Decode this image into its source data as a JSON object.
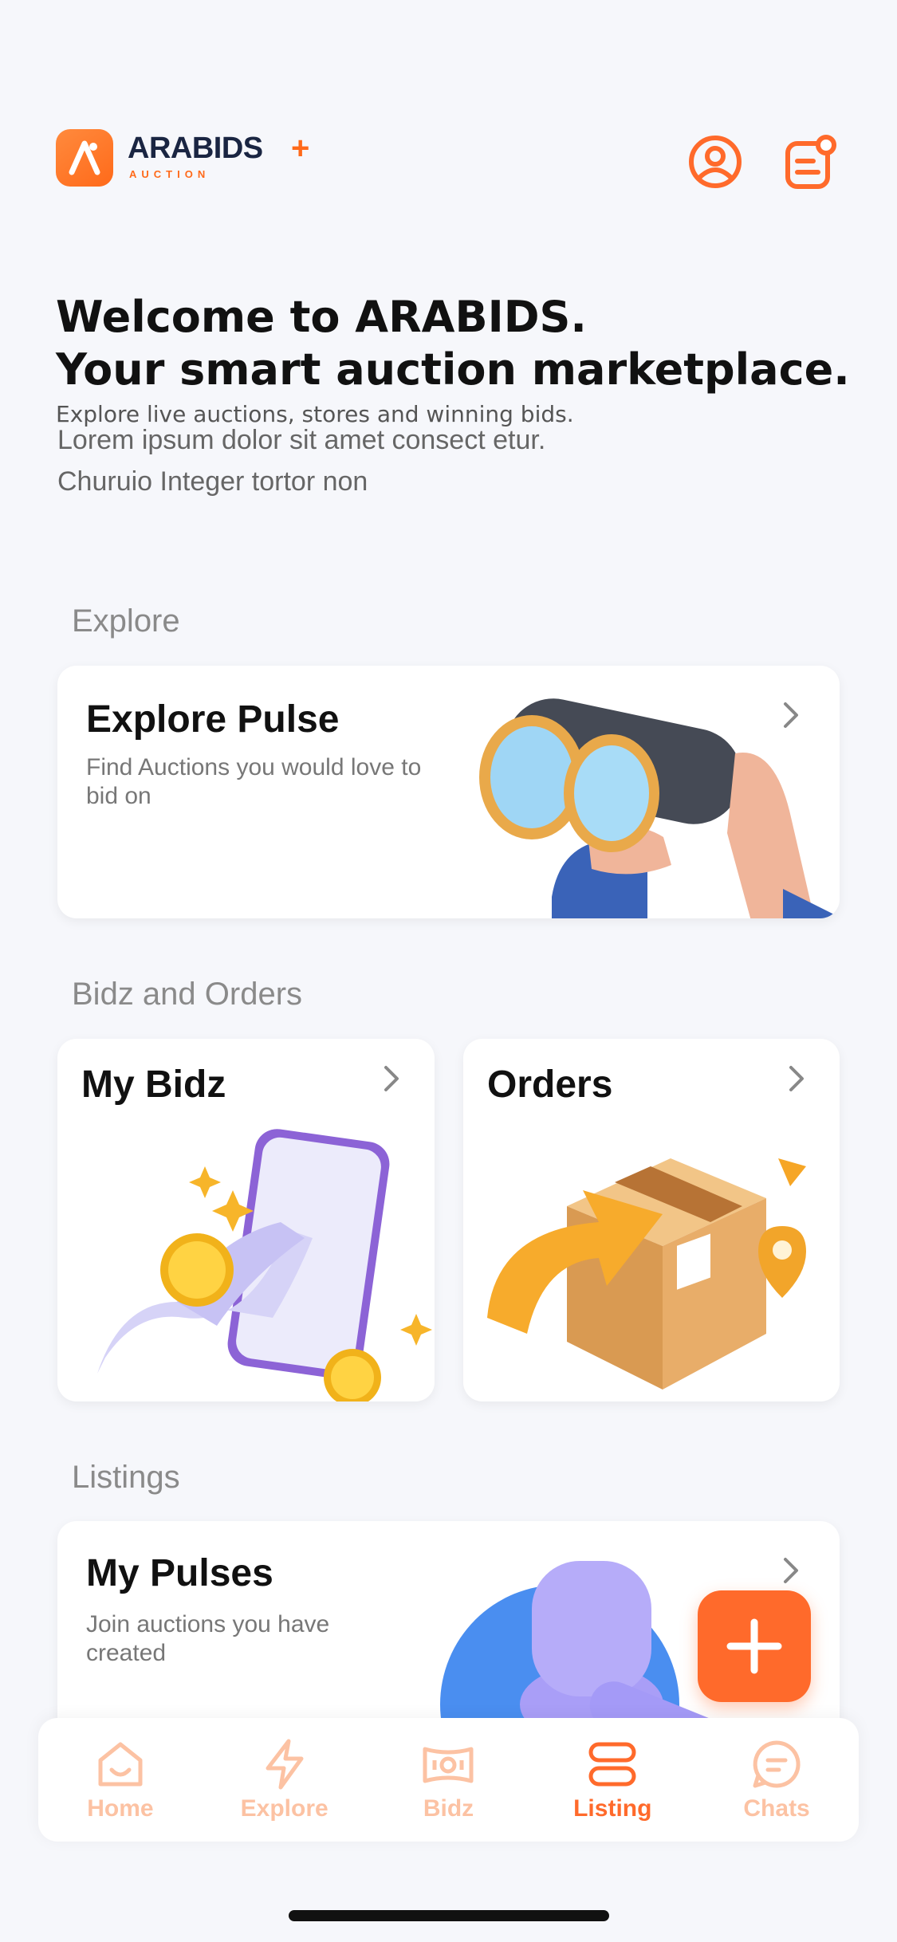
{
  "header": {
    "brand_name": "ARABIDS",
    "brand_sub": "AUCTION",
    "plus": "+",
    "icons": [
      "user-circle-icon",
      "notes-notification-icon"
    ]
  },
  "welcome": {
    "title_line1": "Welcome to ARABIDS.",
    "title_line2": "Your smart auction marketplace.",
    "subtitle": "Explore live auctions, stores and winning bids.",
    "lorem_line1": "Lorem ipsum dolor sit amet consect etur.",
    "lorem_line2": "Churuio Integer tortor non"
  },
  "sections": {
    "explore": {
      "label": "Explore",
      "card_title": "Explore Pulse",
      "card_desc": "Find Auctions you would love to bid on"
    },
    "bidz_orders": {
      "label": "Bidz and Orders",
      "my_bidz": "My Bidz",
      "orders": "Orders"
    },
    "listings": {
      "label": "Listings",
      "card_title": "My Pulses",
      "card_desc": "Join auctions you have created"
    }
  },
  "nav": {
    "items": [
      {
        "label": "Home",
        "icon": "home-icon",
        "active": false
      },
      {
        "label": "Explore",
        "icon": "lightning-icon",
        "active": false
      },
      {
        "label": "Bidz",
        "icon": "ticket-icon",
        "active": false
      },
      {
        "label": "Listing",
        "icon": "listing-icon",
        "active": true
      },
      {
        "label": "Chats",
        "icon": "chat-icon",
        "active": false
      }
    ]
  },
  "colors": {
    "accent": "#ff6a2b",
    "accent_muted": "#fcc2a3",
    "background": "#f6f7fb"
  }
}
